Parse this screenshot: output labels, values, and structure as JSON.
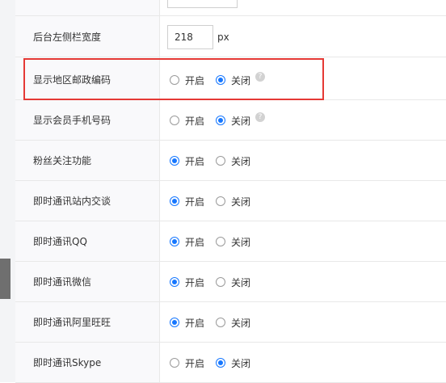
{
  "theme": {
    "accent": "#1677ff",
    "highlight": "#e53935"
  },
  "option_labels": {
    "on": "开启",
    "off": "关闭"
  },
  "rows": [
    {
      "label": "后台左侧栏宽度",
      "type": "input",
      "value": "218",
      "unit": "px"
    },
    {
      "label": "显示地区邮政编码",
      "type": "radio",
      "selected": "off",
      "help_icon": true
    },
    {
      "label": "显示会员手机号码",
      "type": "radio",
      "selected": "off",
      "help_icon": true
    },
    {
      "label": "粉丝关注功能",
      "type": "radio",
      "selected": "on"
    },
    {
      "label": "即时通讯站内交谈",
      "type": "radio",
      "selected": "on"
    },
    {
      "label": "即时通讯QQ",
      "type": "radio",
      "selected": "on"
    },
    {
      "label": "即时通讯微信",
      "type": "radio",
      "selected": "on"
    },
    {
      "label": "即时通讯阿里旺旺",
      "type": "radio",
      "selected": "on"
    },
    {
      "label": "即时通讯Skype",
      "type": "radio",
      "selected": "off"
    }
  ]
}
